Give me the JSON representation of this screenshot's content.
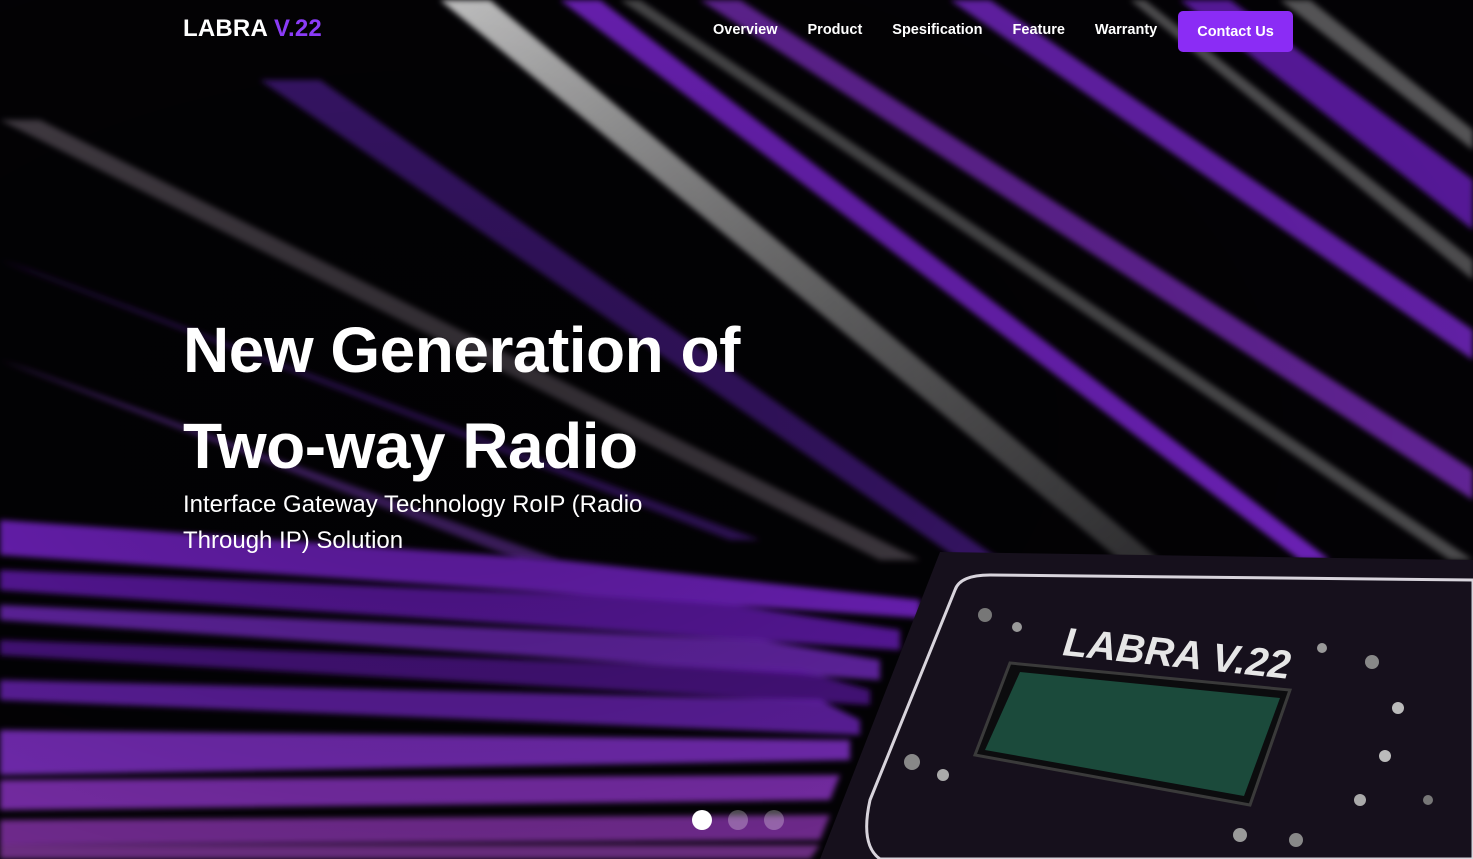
{
  "brand": {
    "name": "LABRA",
    "version": "V.22",
    "accent_color": "#8b3cf7"
  },
  "nav": {
    "links": [
      {
        "label": "Overview"
      },
      {
        "label": "Product"
      },
      {
        "label": "Spesification"
      },
      {
        "label": "Feature"
      },
      {
        "label": "Warranty"
      }
    ],
    "cta_label": "Contact Us",
    "cta_color": "#8b2cf5"
  },
  "hero": {
    "headline": "New Generation of Two-way Radio",
    "subheadline": "Interface Gateway Technology RoIP (Radio Through IP) Solution",
    "device_label": "LABRA V.22",
    "background_colors": {
      "base": "#030205",
      "beam_purple": "#8e2cf2",
      "beam_white": "#e6e6e6"
    }
  },
  "carousel": {
    "slide_count": 3,
    "active_index": 0
  }
}
